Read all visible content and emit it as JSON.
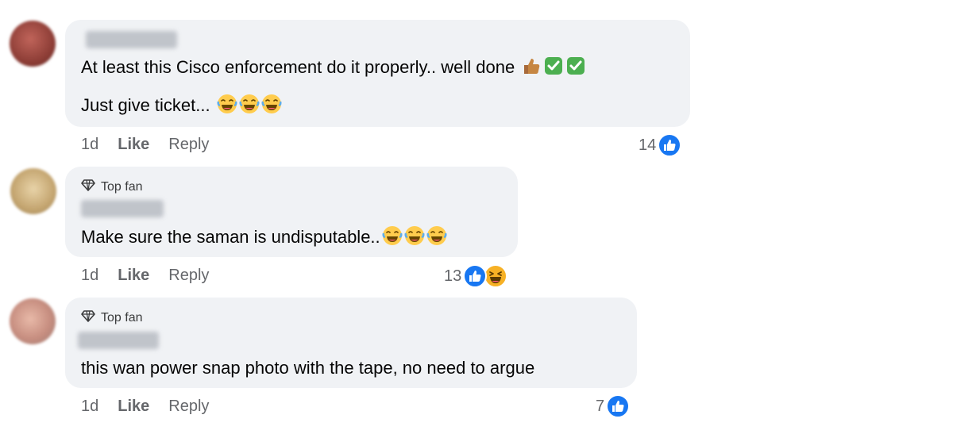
{
  "comments": [
    {
      "top_fan": false,
      "lines": [
        "At least this Cisco enforcement do it properly.. well done",
        "Just give ticket..."
      ],
      "line1_emojis": [
        "thumbs-up-icon",
        "check-icon",
        "check-icon"
      ],
      "line2_emojis": [
        "laughing-icon",
        "laughing-icon",
        "laughing-icon"
      ],
      "time": "1d",
      "like_label": "Like",
      "reply_label": "Reply",
      "reaction_count": "14",
      "reactions": [
        "like-reaction-icon"
      ]
    },
    {
      "top_fan": true,
      "badge": "Top fan",
      "lines": [
        "Make sure the saman is undisputable.."
      ],
      "line1_emojis": [
        "laughing-icon",
        "laughing-icon",
        "laughing-icon"
      ],
      "time": "1d",
      "like_label": "Like",
      "reply_label": "Reply",
      "reaction_count": "13",
      "reactions": [
        "like-reaction-icon",
        "haha-reaction-icon"
      ]
    },
    {
      "top_fan": true,
      "badge": "Top fan",
      "lines": [
        "this wan power snap photo with the tape, no need to argue"
      ],
      "time": "1d",
      "like_label": "Like",
      "reply_label": "Reply",
      "reaction_count": "7",
      "reactions": [
        "like-reaction-icon"
      ]
    }
  ],
  "colors": {
    "bubble": "#f0f2f5",
    "meta_text": "#65676b",
    "like_blue": "#1877f2",
    "check_green": "#4caf50",
    "emoji_yellow": "#ffcc4d"
  }
}
